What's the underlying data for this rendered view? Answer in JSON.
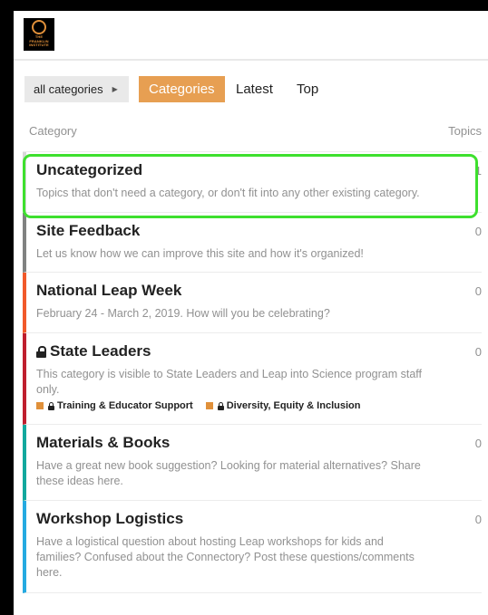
{
  "brand": {
    "logo_lines": [
      "THE",
      "FRANKLIN",
      "INSTITUTE"
    ]
  },
  "nav": {
    "dropdown_label": "all categories",
    "tabs": [
      {
        "label": "Categories",
        "active": true
      },
      {
        "label": "Latest",
        "active": false
      },
      {
        "label": "Top",
        "active": false
      }
    ]
  },
  "table": {
    "col_category": "Category",
    "col_topics": "Topics"
  },
  "categories": [
    {
      "name": "Uncategorized",
      "description": "Topics that don't need a category, or don't fit into any other existing category.",
      "topics": "1",
      "color": "#d8d8d8",
      "locked": false
    },
    {
      "name": "Site Feedback",
      "description": "Let us know how we can improve this site and how it's organized!",
      "topics": "0",
      "color": "#808281",
      "locked": false
    },
    {
      "name": "National Leap Week",
      "description": "February 24 - March 2, 2019. How will you be celebrating?",
      "topics": "0",
      "color": "#f1592a",
      "locked": false
    },
    {
      "name": "State Leaders",
      "description": "This category is visible to State Leaders and Leap into Science program staff only.",
      "topics": "0",
      "color": "#bf1e2e",
      "locked": true,
      "subcategories": [
        {
          "name": "Training & Educator Support",
          "color": "#e0903a",
          "locked": true
        },
        {
          "name": "Diversity, Equity & Inclusion",
          "color": "#e0903a",
          "locked": true
        }
      ]
    },
    {
      "name": "Materials & Books",
      "description": "Have a great new book suggestion? Looking for material alternatives? Share these ideas here.",
      "topics": "0",
      "color": "#12a89d",
      "locked": false
    },
    {
      "name": "Workshop Logistics",
      "description": "Have a logistical question about hosting Leap workshops for kids and families? Confused about the Connectory? Post these questions/comments here.",
      "topics": "0",
      "color": "#25aae1",
      "locked": false
    }
  ],
  "colors": {
    "accent": "#e79f52",
    "highlight": "#3ee02e"
  }
}
